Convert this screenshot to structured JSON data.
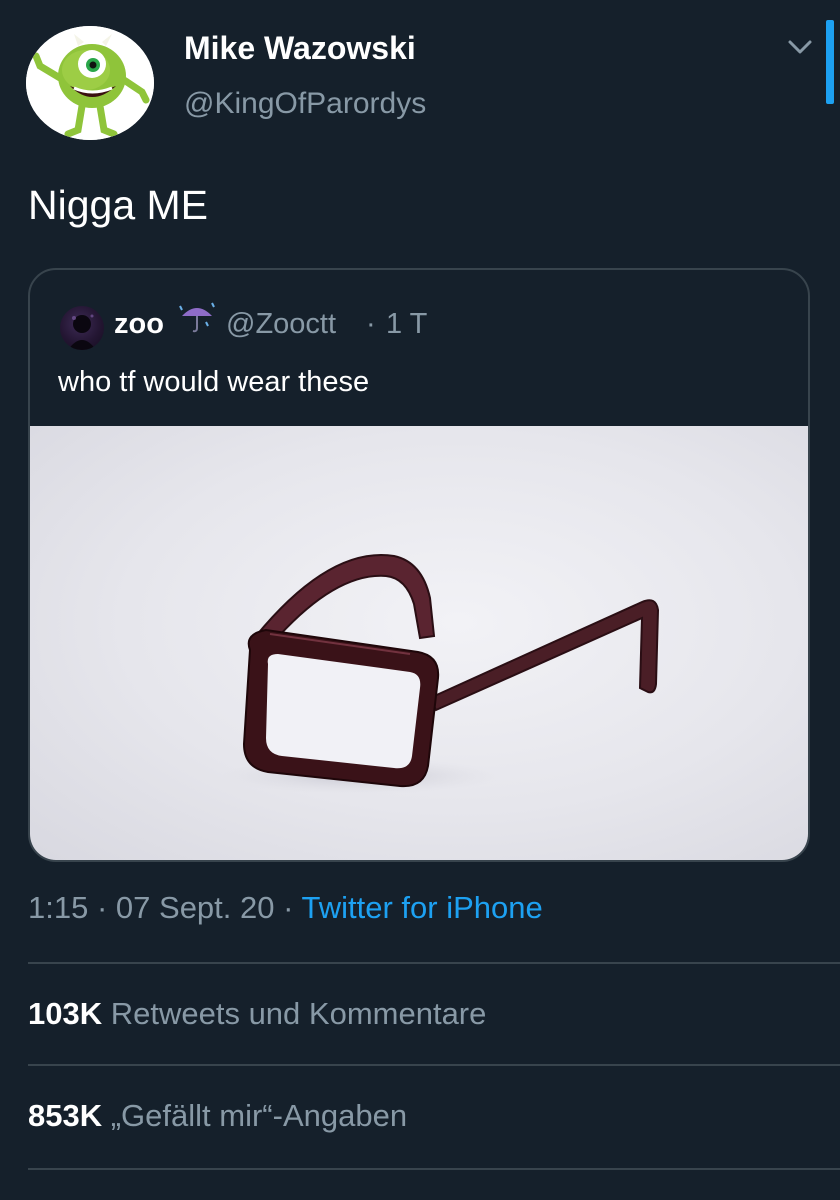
{
  "author": {
    "display_name": "Mike Wazowski",
    "handle": "@KingOfParordys",
    "avatar_icon": "mike-wazowski-avatar"
  },
  "tweet": {
    "text": "Nigga ME"
  },
  "quoted_tweet": {
    "name": "zoo",
    "name_emoji_icon": "umbrella-with-rain-icon",
    "handle": "@Zooctt",
    "separator": "·",
    "time": "1 T",
    "text": "who tf would wear these",
    "image_icon": "upside-down-glasses-image"
  },
  "meta": {
    "time": "1:15",
    "sep1": "·",
    "date": "07 Sept. 20",
    "sep2": "·",
    "source": "Twitter for iPhone"
  },
  "stats": {
    "retweets_count": "103K",
    "retweets_label": "Retweets und Kommentare",
    "likes_count": "853K",
    "likes_label": "„Gefällt mir“-Angaben"
  },
  "colors": {
    "background": "#15202b",
    "accent": "#1da1f2",
    "muted": "#8899a6",
    "border": "#38444d"
  }
}
